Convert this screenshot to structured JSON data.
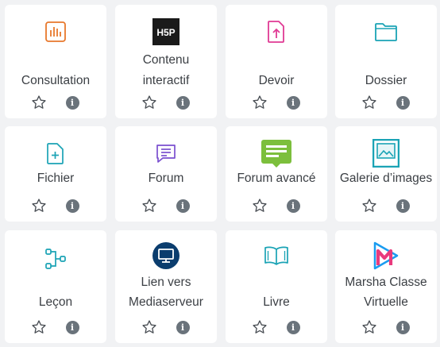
{
  "activities": [
    {
      "name": "Consultation",
      "icon": "poll-chart-icon",
      "color": "#e8782c"
    },
    {
      "name": "Contenu interactif",
      "lines": [
        "Contenu",
        "interactif"
      ],
      "icon": "h5p-logo-icon",
      "color": "#1a1a1a"
    },
    {
      "name": "Devoir",
      "icon": "file-upload-icon",
      "color": "#e03a94"
    },
    {
      "name": "Dossier",
      "icon": "folder-icon",
      "color": "#1aa3b5"
    },
    {
      "name": "Fichier",
      "icon": "file-plus-icon",
      "color": "#1aa3b5"
    },
    {
      "name": "Forum",
      "icon": "chat-bubble-icon",
      "color": "#7a4fcf"
    },
    {
      "name": "Forum avancé",
      "icon": "forum-board-icon",
      "color": "#7cbf3c"
    },
    {
      "name": "Galerie d’images",
      "icon": "image-gallery-icon",
      "color": "#1aa3b5"
    },
    {
      "name": "Leçon",
      "icon": "lesson-flow-icon",
      "color": "#1aa3b5"
    },
    {
      "name": "Lien vers Mediaserveur",
      "lines": [
        "Lien vers",
        "Mediaserveur"
      ],
      "icon": "media-server-icon",
      "color": "#0b3d6e"
    },
    {
      "name": "Livre",
      "icon": "book-icon",
      "color": "#1aa3b5"
    },
    {
      "name": "Marsha Classe Virtuelle",
      "lines": [
        "Marsha Classe",
        "Virtuelle"
      ],
      "icon": "marsha-logo-icon",
      "color": "#e93a7d"
    }
  ],
  "actions": {
    "star_icon": "star-outline-icon",
    "info_icon": "info-icon",
    "info_glyph": "i"
  }
}
